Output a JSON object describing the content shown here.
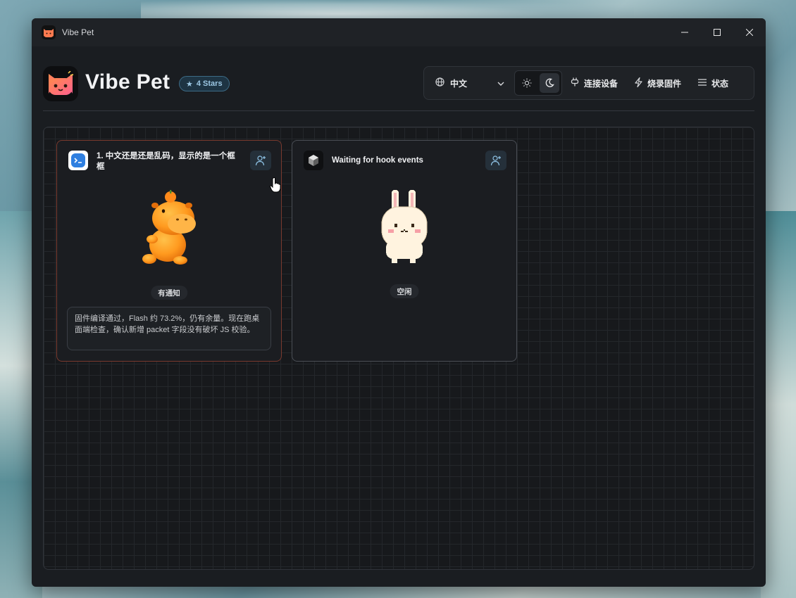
{
  "window": {
    "title": "Vibe Pet"
  },
  "header": {
    "app_name": "Vibe Pet",
    "stars_badge": "4 Stars",
    "language": "中文",
    "connect_device": "连接设备",
    "flash_firmware": "烧录固件",
    "status": "状态",
    "theme": "dark"
  },
  "cards": [
    {
      "title": "1. 中文还是还是乱码，显示的是一个框框",
      "status": "有通知",
      "message": "固件编译通过，Flash 约 73.2%，仍有余量。现在跑桌面端检查，确认新增 packet 字段没有破坏 JS 校验。",
      "pet": "orange-hippo"
    },
    {
      "title": "Waiting for hook events",
      "status": "空闲",
      "pet": "white-bunny"
    }
  ],
  "colors": {
    "accent": "#3d6b86",
    "alert_border": "#7a3a2e",
    "background": "#1a1d21"
  }
}
